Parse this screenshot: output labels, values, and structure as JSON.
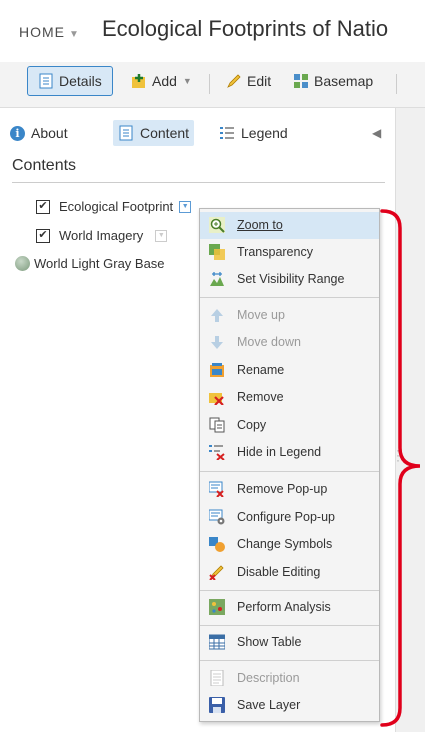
{
  "header": {
    "home_label": "HOME",
    "title": "Ecological Footprints of Natio"
  },
  "toolbar": {
    "details": "Details",
    "add": "Add",
    "edit": "Edit",
    "basemap": "Basemap"
  },
  "tabs": {
    "about": "About",
    "content": "Content",
    "legend": "Legend"
  },
  "contents_title": "Contents",
  "layers": [
    {
      "name": "Ecological Footprint",
      "checked": true
    },
    {
      "name": "World Imagery",
      "checked": true
    },
    {
      "name": "World Light Gray Base"
    }
  ],
  "menu": {
    "items": [
      {
        "label": "Zoom to",
        "icon": "zoom-icon",
        "highlighted": true
      },
      {
        "label": "Transparency",
        "icon": "transparency-icon"
      },
      {
        "label": "Set Visibility Range",
        "icon": "visibility-range-icon"
      },
      {
        "label": "Move up",
        "icon": "arrow-up-icon",
        "disabled": true
      },
      {
        "label": "Move down",
        "icon": "arrow-down-icon",
        "disabled": true
      },
      {
        "label": "Rename",
        "icon": "rename-icon"
      },
      {
        "label": "Remove",
        "icon": "remove-icon"
      },
      {
        "label": "Copy",
        "icon": "copy-icon"
      },
      {
        "label": "Hide in Legend",
        "icon": "hide-legend-icon"
      },
      {
        "label": "Remove Pop-up",
        "icon": "remove-popup-icon"
      },
      {
        "label": "Configure Pop-up",
        "icon": "configure-popup-icon"
      },
      {
        "label": "Change Symbols",
        "icon": "change-symbols-icon"
      },
      {
        "label": "Disable Editing",
        "icon": "disable-editing-icon"
      },
      {
        "label": "Perform Analysis",
        "icon": "analysis-icon"
      },
      {
        "label": "Show Table",
        "icon": "table-icon"
      },
      {
        "label": "Description",
        "icon": "description-icon",
        "disabled": true
      },
      {
        "label": "Save Layer",
        "icon": "save-icon"
      }
    ]
  },
  "colors": {
    "accent": "#3a86c8",
    "highlight": "#d6e7f5",
    "bracket": "#e0001b"
  }
}
